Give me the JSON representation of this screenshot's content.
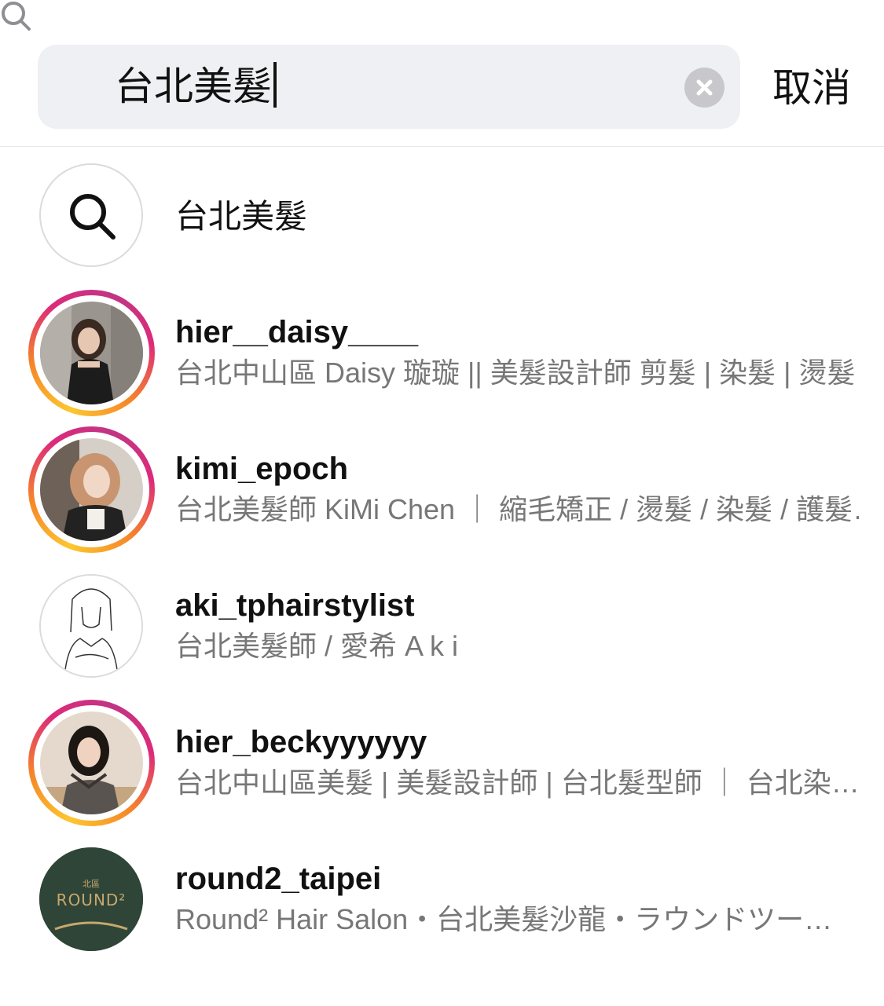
{
  "search": {
    "query": "台北美髮",
    "cancel_label": "取消"
  },
  "suggestion": {
    "label": "台北美髮"
  },
  "results": [
    {
      "username": "hier__daisy____",
      "bio": "台北中山區 Daisy 璇璇 || 美髮設計師 剪髮 | 染髮 | 燙髮…",
      "has_story": true,
      "avatar": "portrait-woman-black-dress"
    },
    {
      "username": "kimi_epoch",
      "bio": "台北美髮師 KiMi Chen ｜ 縮毛矯正 / 燙髮 / 染髮 / 護髮…",
      "has_story": true,
      "avatar": "portrait-woman-blonde"
    },
    {
      "username": "aki_tphairstylist",
      "bio": "台北美髮師 / 愛希 A k i",
      "has_story": false,
      "avatar": "line-drawing-girl"
    },
    {
      "username": "hier_beckyyyyyy",
      "bio": "台北中山區美髮 | 美髮設計師 | 台北髮型師 ｜ 台北染…",
      "has_story": true,
      "avatar": "portrait-woman-dark-hair"
    },
    {
      "username": "round2_taipei",
      "bio": "Round² Hair Salon・台北美髮沙龍・ラウンドツー…",
      "has_story": false,
      "avatar": "round2-logo",
      "logo": {
        "top": "北區",
        "main": "ROUND²"
      }
    }
  ],
  "colors": {
    "search_bg": "#eff0f3",
    "story_ring_start": "#fdc72f",
    "story_ring_end": "#c13584",
    "logo_bg": "#2f4538",
    "secondary_text": "#777777"
  }
}
